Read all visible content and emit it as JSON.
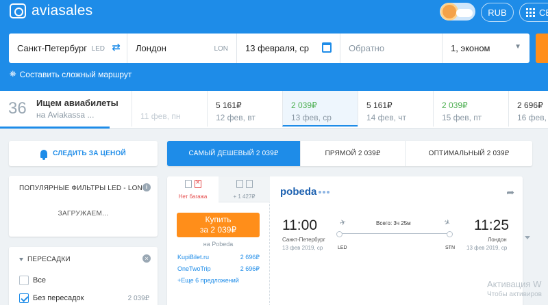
{
  "header": {
    "logo_text": "aviasales",
    "currency_label": "RUB",
    "services_label": "СЕ"
  },
  "search": {
    "from_city": "Санкт-Петербург",
    "from_iata": "LED",
    "to_city": "Лондон",
    "to_iata": "LON",
    "depart_date": "13 февраля, ср",
    "return_placeholder": "Обратно",
    "passengers": "1, эконом",
    "complex_route_label": "Составить сложный маршрут"
  },
  "progress": {
    "count": "36",
    "title": "Ищем авиабилеты",
    "subtitle": "на Aviakassa ..."
  },
  "days": [
    {
      "price": "",
      "date": "11 фев, пн",
      "state": "empty"
    },
    {
      "price": "5 161₽",
      "date": "12 фев, вт",
      "state": "normal"
    },
    {
      "price": "2 039₽",
      "date": "13 фев, ср",
      "state": "selected"
    },
    {
      "price": "5 161₽",
      "date": "14 фев, чт",
      "state": "normal"
    },
    {
      "price": "2 039₽",
      "date": "15 фев, пт",
      "state": "cheap"
    },
    {
      "price": "2 696₽",
      "date": "16 фев, сб",
      "state": "normal"
    }
  ],
  "sidebar": {
    "subscribe_label": "СЛЕДИТЬ ЗА ЦЕНОЙ",
    "popular_title": "ПОПУЛЯРНЫЕ ФИЛЬТРЫ LED - LON",
    "popular_loading": "ЗАГРУЖАЕМ...",
    "stops_title": "ПЕРЕСАДКИ",
    "stops_options": [
      {
        "label": "Все",
        "price": "",
        "checked": false
      },
      {
        "label": "Без пересадок",
        "price": "2 039₽",
        "checked": true
      }
    ]
  },
  "sort_tabs": [
    {
      "label": "САМЫЙ ДЕШЕВЫЙ 2 039₽",
      "active": true
    },
    {
      "label": "ПРЯМОЙ 2 039₽",
      "active": false
    },
    {
      "label": "ОПТИМАЛЬНЫЙ 2 039₽",
      "active": false
    }
  ],
  "ticket": {
    "baggage_tabs": [
      {
        "label": "Нет багажа",
        "icon_left": "7",
        "icon_right": ""
      },
      {
        "label": "+ 1 427₽",
        "icon_left": "7",
        "icon_right": "20"
      }
    ],
    "buy_label": "Купить",
    "buy_price": "за 2 039₽",
    "buy_sub": "на Pobeda",
    "agencies": [
      {
        "name": "KupiBilet.ru",
        "price": "2 696₽"
      },
      {
        "name": "OneTwoTrip",
        "price": "2 696₽"
      }
    ],
    "more_offers": "+Еще 6 предложений",
    "airline_name": "pobeda",
    "depart_time": "11:00",
    "arrive_time": "11:25",
    "duration": "Всего: 3ч 25м",
    "depart_city": "Санкт-Петербург",
    "arrive_city": "Лондон",
    "depart_date": "13 фев 2019, ср",
    "arrive_date": "13 фев 2019, ср",
    "depart_iata": "LED",
    "arrive_iata": "STN"
  },
  "watermark": {
    "line1": "Активация W",
    "line2": "Чтобы активиров"
  },
  "colors": {
    "brand_blue": "#1e8ce8",
    "buy_orange": "#ff8e1a",
    "cheap_green": "#4caf50",
    "no_bag_red": "#e54b4b"
  }
}
